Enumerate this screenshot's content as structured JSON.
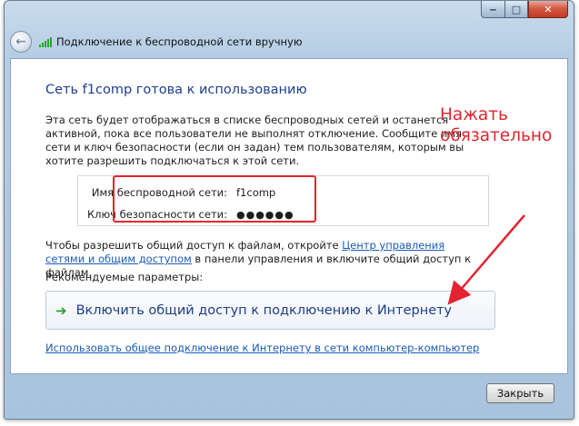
{
  "window": {
    "title": "Подключение к беспроводной сети вручную",
    "caption": {
      "minimize": "‒",
      "maximize": "□",
      "close": "✕"
    },
    "back_glyph": "←"
  },
  "main": {
    "heading": "Сеть f1comp готова к использованию",
    "description": "Эта сеть будет отображаться в списке беспроводных сетей и останется активной, пока все пользователи не выполнят отключение. Сообщите имя сети и ключ безопасности (если он задан) тем пользователям, которым вы хотите разрешить подключаться к этой сети.",
    "network_name_label": "Имя беспроводной сети:",
    "network_name_value": "f1comp",
    "security_key_label": "Ключ безопасности сети:",
    "security_key_value": "●●●●●●",
    "share_text_before": "Чтобы разрешить общий доступ к файлам, откройте ",
    "share_link": "Центр управления сетями и общим доступом",
    "share_text_after": " в панели управления и включите общий доступ к файлам.",
    "recommended_label": "Рекомендуемые параметры:",
    "enable_sharing_button": "Включить общий доступ к подключению к Интернету",
    "adhoc_link": "Использовать общее подключение к Интернету в сети компьютер-компьютер"
  },
  "annotation": {
    "line1": "Нажать",
    "line2": "обязательно",
    "color": "#e0262d"
  },
  "footer": {
    "close_button": "Закрыть"
  },
  "colors": {
    "heading": "#1f3f8a",
    "link": "#1a5bb8",
    "annotation_red": "#e3232f",
    "arrow_green": "#2c9e2c"
  }
}
